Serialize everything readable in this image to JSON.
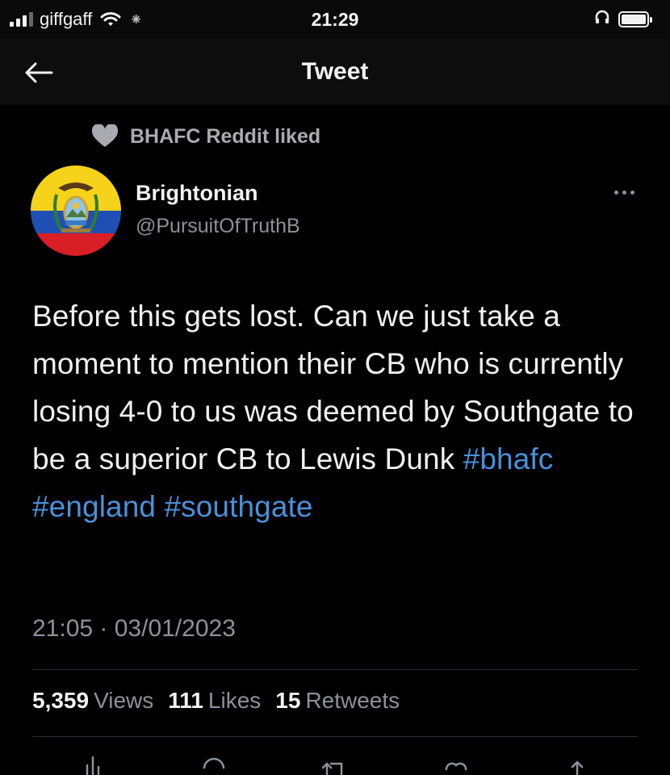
{
  "status_bar": {
    "carrier": "giffgaff",
    "time": "21:29"
  },
  "header": {
    "title": "Tweet"
  },
  "social_context": {
    "text": "BHAFC Reddit liked"
  },
  "author": {
    "name": "Brightonian",
    "handle": "@PursuitOfTruthB"
  },
  "tweet": {
    "text": "Before this gets lost. Can we just take a moment to mention their CB who is currently losing 4-0 to us was deemed by Southgate to be a superior CB to Lewis Dunk",
    "hashtags": [
      "#bhafc",
      "#england",
      "#southgate"
    ],
    "timestamp": "21:05 · 03/01/2023"
  },
  "stats": {
    "views_count": "5,359",
    "views_label": "Views",
    "likes_count": "111",
    "likes_label": "Likes",
    "retweets_count": "15",
    "retweets_label": "Retweets"
  },
  "icons": {
    "back": "arrow-left-icon",
    "social": "heart-icon",
    "more": "more-horizontal-icon",
    "actions": [
      "analytics-icon",
      "reply-icon",
      "retweet-icon",
      "like-icon",
      "share-icon"
    ]
  },
  "colors": {
    "background": "#000000",
    "hashtag": "#4a90d9",
    "secondary_text": "#8b9299",
    "flag_yellow": "#f6d31a",
    "flag_blue": "#1f4fb4",
    "flag_red": "#d91f26"
  }
}
